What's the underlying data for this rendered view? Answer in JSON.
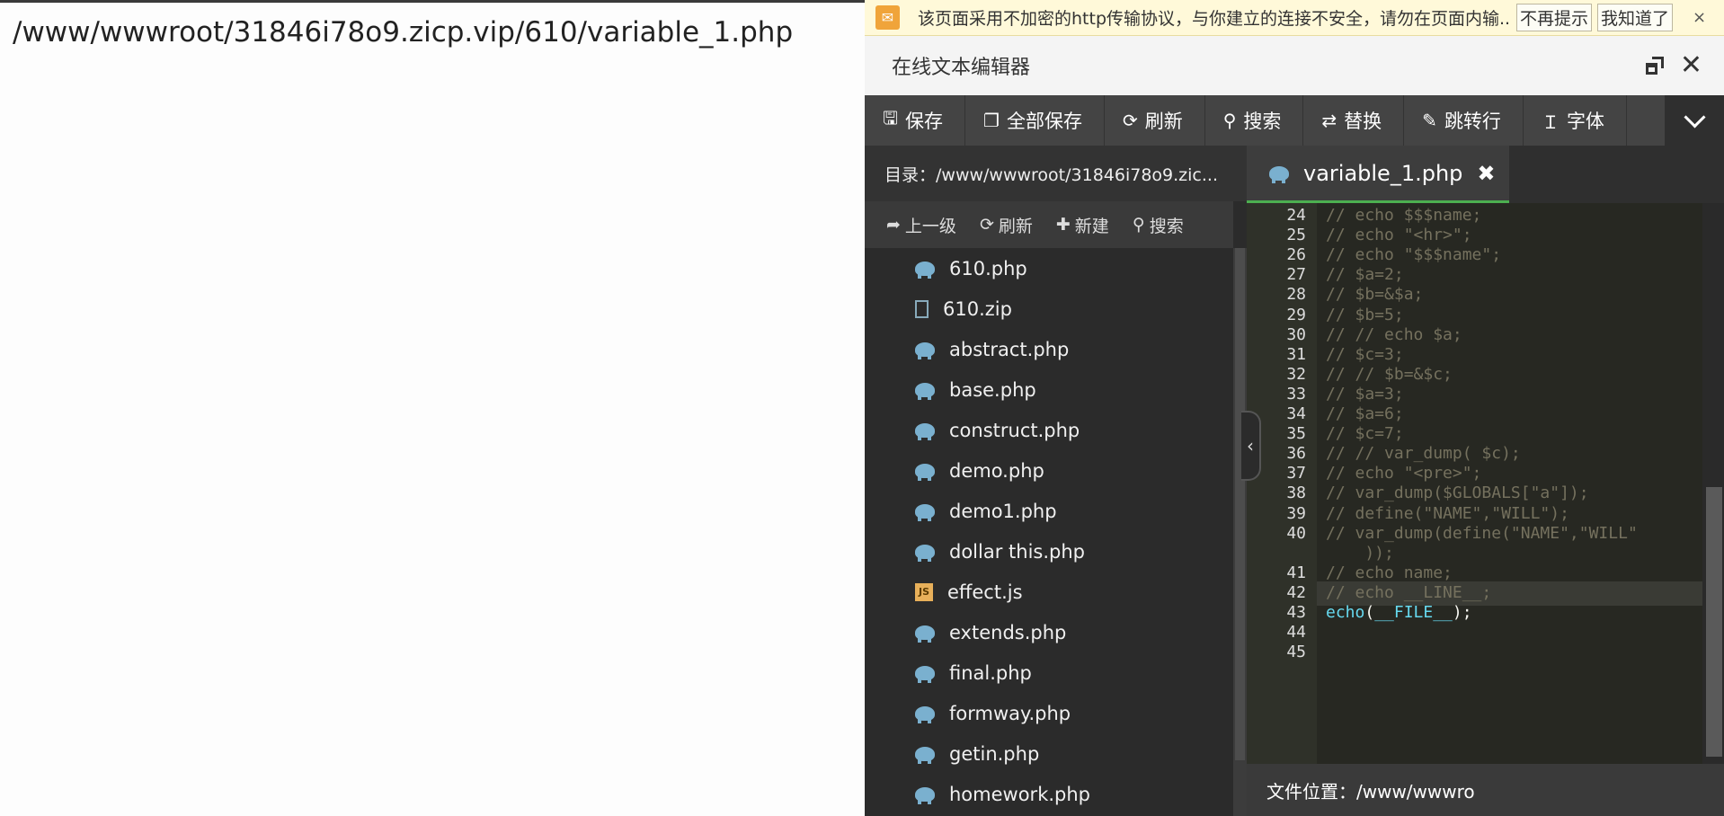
{
  "browser_output": "/www/wwwroot/31846i78o9.zicp.vip/610/variable_1.php",
  "notice": {
    "message": "该页面采用不加密的http传输协议，与你建立的连接不安全，请勿在页面内输...",
    "dont_remind": "不再提示",
    "got_it": "我知道了",
    "close": "×"
  },
  "window": {
    "title": "在线文本编辑器",
    "close": "✕"
  },
  "toolbar": [
    {
      "icon": "save-icon",
      "label": "保存",
      "glyph": "🖫"
    },
    {
      "icon": "save-all-icon",
      "label": "全部保存",
      "glyph": "❐"
    },
    {
      "icon": "refresh-icon",
      "label": "刷新",
      "glyph": "⟳"
    },
    {
      "icon": "search-icon",
      "label": "搜索",
      "glyph": "⚲"
    },
    {
      "icon": "replace-icon",
      "label": "替换",
      "glyph": "⇄"
    },
    {
      "icon": "pin-icon",
      "label": "跳转行",
      "glyph": "✎"
    },
    {
      "icon": "font-icon",
      "label": "字体",
      "glyph": "Ｉ"
    }
  ],
  "directory": {
    "label": "目录：/www/wwwroot/31846i78o9.zic..."
  },
  "file_tools": [
    {
      "label": "上一级",
      "glyph": "➦",
      "icon": "up-level-icon"
    },
    {
      "label": "刷新",
      "glyph": "⟳",
      "icon": "refresh-icon"
    },
    {
      "label": "新建",
      "glyph": "✚",
      "icon": "new-icon"
    },
    {
      "label": "搜索",
      "glyph": "⚲",
      "icon": "search-icon"
    }
  ],
  "files": [
    {
      "name": "610.php",
      "type": "php"
    },
    {
      "name": "610.zip",
      "type": "zip"
    },
    {
      "name": "abstract.php",
      "type": "php"
    },
    {
      "name": "base.php",
      "type": "php"
    },
    {
      "name": "construct.php",
      "type": "php"
    },
    {
      "name": "demo.php",
      "type": "php"
    },
    {
      "name": "demo1.php",
      "type": "php"
    },
    {
      "name": "dollar this.php",
      "type": "php"
    },
    {
      "name": "effect.js",
      "type": "js"
    },
    {
      "name": "extends.php",
      "type": "php"
    },
    {
      "name": "final.php",
      "type": "php"
    },
    {
      "name": "formway.php",
      "type": "php"
    },
    {
      "name": "getin.php",
      "type": "php"
    },
    {
      "name": "homework.php",
      "type": "php"
    }
  ],
  "tab": {
    "filename": "variable_1.php",
    "close": "✖"
  },
  "code_lines": [
    {
      "n": "24",
      "text": "// echo $$$name;"
    },
    {
      "n": "25",
      "text": "// echo \"<hr>\";"
    },
    {
      "n": "26",
      "text": "// echo \"$$$name\";"
    },
    {
      "n": "27",
      "text": "// $a=2;"
    },
    {
      "n": "28",
      "text": "// $b=&$a;"
    },
    {
      "n": "29",
      "text": "// $b=5;"
    },
    {
      "n": "30",
      "text": "// // echo $a;"
    },
    {
      "n": "31",
      "text": "// $c=3;"
    },
    {
      "n": "32",
      "text": "// // $b=&$c;"
    },
    {
      "n": "33",
      "text": "// $a=3;"
    },
    {
      "n": "34",
      "text": "// $a=6;"
    },
    {
      "n": "35",
      "text": "// $c=7;"
    },
    {
      "n": "36",
      "text": "// // var_dump( $c);"
    },
    {
      "n": "37",
      "text": "// echo \"<pre>\";"
    },
    {
      "n": "38",
      "text": "// var_dump($GLOBALS[\"a\"]);"
    },
    {
      "n": "39",
      "text": "// define(\"NAME\",\"WILL\");"
    },
    {
      "n": "40",
      "text": "// var_dump(define(\"NAME\",\"WILL\""
    },
    {
      "n": "",
      "text": "    ));"
    },
    {
      "n": "41",
      "text": "// echo name;"
    },
    {
      "n": "42",
      "text": "// echo __LINE__;"
    },
    {
      "n": "43",
      "text": "echo(__FILE__);",
      "kind": "code"
    },
    {
      "n": "44",
      "text": ""
    },
    {
      "n": "45",
      "text": ""
    }
  ],
  "active_line": "42",
  "status": {
    "label": "文件位置：/www/wwwro"
  }
}
